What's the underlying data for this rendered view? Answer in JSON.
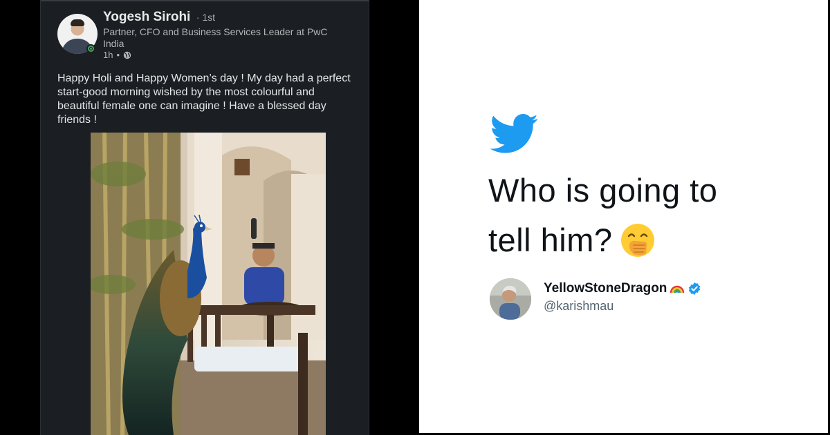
{
  "linkedin_post": {
    "author_name": "Yogesh Sirohi",
    "connection_degree": "· 1st",
    "headline": "Partner, CFO and Business Services Leader at PwC India",
    "time": "1h",
    "post_text": "Happy Holi and Happy Women’s day ! My day had a perfect start-good morning wished by the most colourful and beautiful female one can imagine ! Have a blessed day friends !",
    "icons": {
      "visibility": "globe-icon",
      "presence": "online-status-icon"
    }
  },
  "tweet": {
    "text_line1": "Who is going to",
    "text_line2": "tell him?",
    "author_display_name": "YellowStoneDragon",
    "author_handle": "@karishmau",
    "icons": {
      "platform": "twitter-bird-icon",
      "emoji": "face-with-hand-over-mouth-emoji",
      "name_emoji": "rainbow-emoji",
      "badge": "verified-badge-icon"
    }
  },
  "colors": {
    "twitter_blue": "#1d9bf0",
    "linkedin_dark_bg": "#1b1f23",
    "online_green": "#4a9e5c"
  }
}
